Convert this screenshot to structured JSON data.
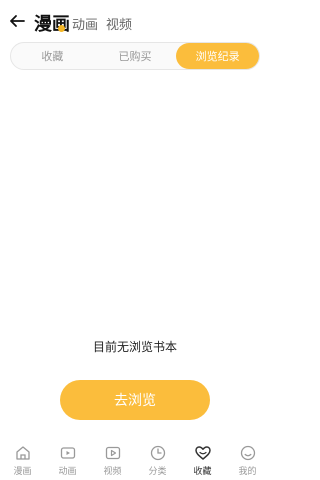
{
  "header": {
    "back_icon": "arrow-left-icon",
    "tabs": [
      {
        "label": "漫画",
        "active": true
      },
      {
        "label": "动画",
        "active": false
      },
      {
        "label": "视频",
        "active": false
      }
    ]
  },
  "segments": [
    {
      "label": "收藏",
      "active": false
    },
    {
      "label": "已购买",
      "active": false
    },
    {
      "label": "浏览纪录",
      "active": true
    }
  ],
  "empty": {
    "message": "目前无浏览书本",
    "button_label": "去浏览"
  },
  "nav": [
    {
      "label": "漫画",
      "icon": "home-icon",
      "active": false
    },
    {
      "label": "动画",
      "icon": "tv-icon",
      "active": false
    },
    {
      "label": "视频",
      "icon": "play-icon",
      "active": false
    },
    {
      "label": "分类",
      "icon": "clock-icon",
      "active": false
    },
    {
      "label": "收藏",
      "icon": "heart-icon",
      "active": true
    },
    {
      "label": "我的",
      "icon": "user-icon",
      "active": false
    }
  ],
  "colors": {
    "accent": "#fbbd3c",
    "dot": "#f5b625",
    "inactive_text": "#999999"
  }
}
